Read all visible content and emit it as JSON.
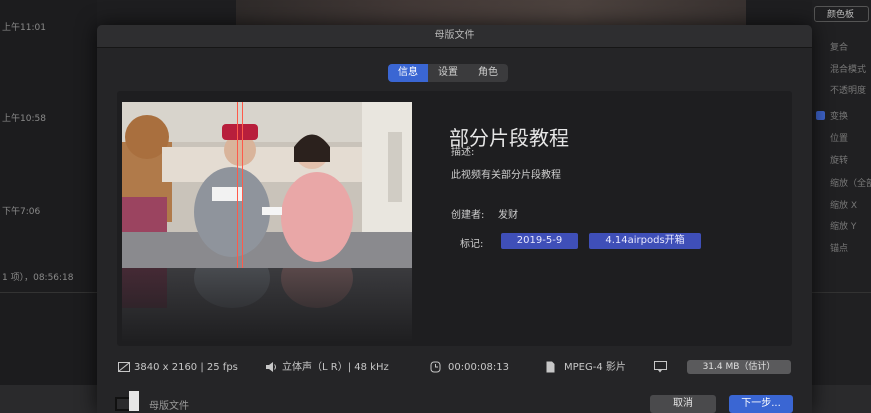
{
  "background": {
    "left_times": [
      "上午11:01",
      "上午10:58",
      "下午7:06",
      "1 项），08:56:18"
    ],
    "right_header": "颜色板",
    "right_items": [
      "复合",
      "混合模式",
      "不透明度",
      "变换",
      "位置",
      "旋转",
      "缩放（全部）",
      "缩放 X",
      "缩放 Y",
      "锚点"
    ]
  },
  "dialog": {
    "title": "母版文件",
    "tabs": [
      {
        "label": "信息",
        "active": true
      },
      {
        "label": "设置",
        "active": false
      },
      {
        "label": "角色",
        "active": false
      }
    ],
    "project_title": "部分片段教程",
    "description_label": "描述:",
    "description": "此视频有关部分片段教程",
    "creator_label": "创建者:",
    "creator": "发财",
    "tags_label": "标记:",
    "tags": [
      "2019-5-9",
      "4.14airpods开箱"
    ],
    "info": {
      "resolution": "3840 x 2160 | 25 fps",
      "audio": "立体声（L R）| 48 kHz",
      "duration": "00:00:08:13",
      "format": "MPEG-4 影片",
      "size": "31.4 MB（估计）"
    },
    "footer": {
      "destination_label": "母版文件",
      "cancel": "取消",
      "next": "下一步..."
    }
  },
  "colors": {
    "accent": "#3a66d3",
    "tag": "#3f4fb8"
  }
}
